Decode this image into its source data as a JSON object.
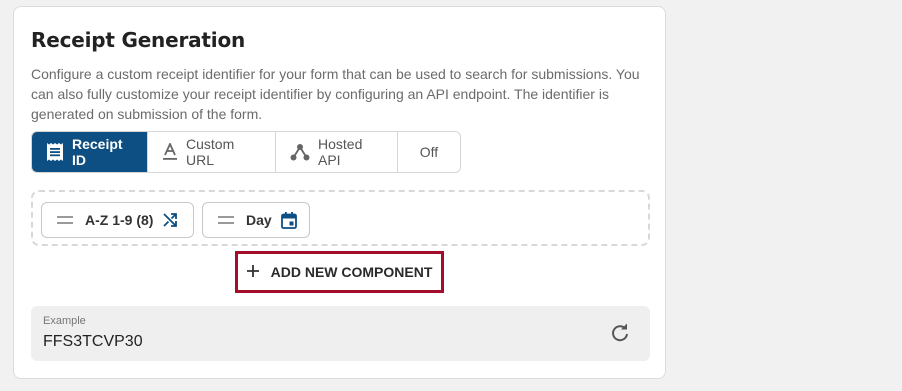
{
  "section": {
    "title": "Receipt Generation",
    "description": "Configure a custom receipt identifier for your form that can be used to search for submissions. You can also fully customize your receipt identifier by configuring an API endpoint. The identifier is generated on submission of the form."
  },
  "tabs": [
    {
      "label": "Receipt ID",
      "icon": "receipt-icon",
      "active": true
    },
    {
      "label": "Custom URL",
      "icon": "text-format-icon",
      "active": false
    },
    {
      "label": "Hosted API",
      "icon": "webhook-icon",
      "active": false
    },
    {
      "label": "Off",
      "icon": "",
      "active": false
    }
  ],
  "components": [
    {
      "label": "A-Z 1-9 (8)",
      "icon": "shuffle-icon"
    },
    {
      "label": "Day",
      "icon": "calendar-icon"
    }
  ],
  "add_button": {
    "label": "ADD NEW COMPONENT",
    "icon": "plus-icon"
  },
  "example": {
    "label": "Example",
    "value": "FFS3TCVP30",
    "icon": "refresh-icon"
  },
  "colors": {
    "primary": "#0d4f83",
    "highlight": "#a50d2c",
    "background": "#f1f1f1"
  }
}
